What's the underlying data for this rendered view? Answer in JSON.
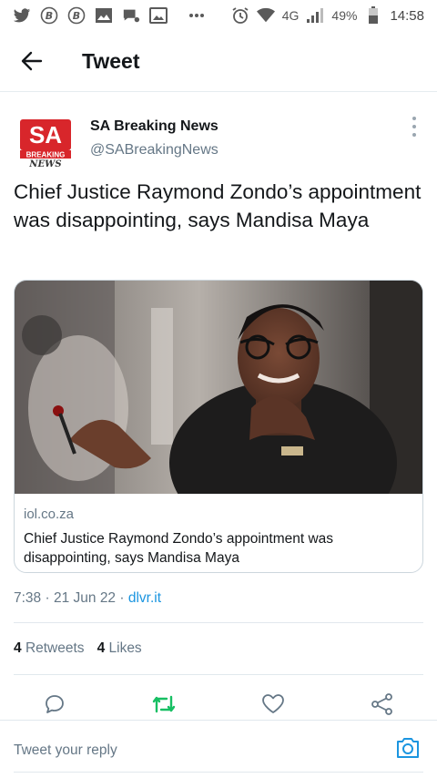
{
  "status_bar": {
    "network": "4G",
    "battery": "49%",
    "time": "14:58",
    "left_icons": [
      "twitter-icon",
      "b-circle-icon",
      "b-circle-icon",
      "image-icon",
      "chat-icon",
      "gallery-icon",
      "more-dots-icon"
    ],
    "right_icons": [
      "alarm-icon",
      "wifi-icon",
      "signal-icon",
      "battery-icon"
    ]
  },
  "header": {
    "title": "Tweet"
  },
  "tweet": {
    "author_name": "SA Breaking News",
    "author_handle": "@SABreakingNews",
    "avatar_logo": {
      "top": "SA",
      "middle": "BREAKING",
      "bottom": "NEWS"
    },
    "text": "Chief Justice Raymond Zondo’s appointment was disappointing, says Mandisa Maya",
    "card": {
      "domain": "iol.co.za",
      "title": "Chief Justice Raymond Zondo’s appointment was disappointing, says Mandisa Maya"
    },
    "time": "7:38",
    "date": "21 Jun 22",
    "separator": "·",
    "source": "dlvr.it",
    "retweets_count": "4",
    "retweets_label": "Retweets",
    "likes_count": "4",
    "likes_label": "Likes"
  },
  "reply": {
    "placeholder": "Tweet your reply"
  },
  "colors": {
    "accent": "#1b95e0",
    "retweet_green": "#17bf63",
    "logo_red": "#d8262b",
    "text_secondary": "#657786"
  }
}
